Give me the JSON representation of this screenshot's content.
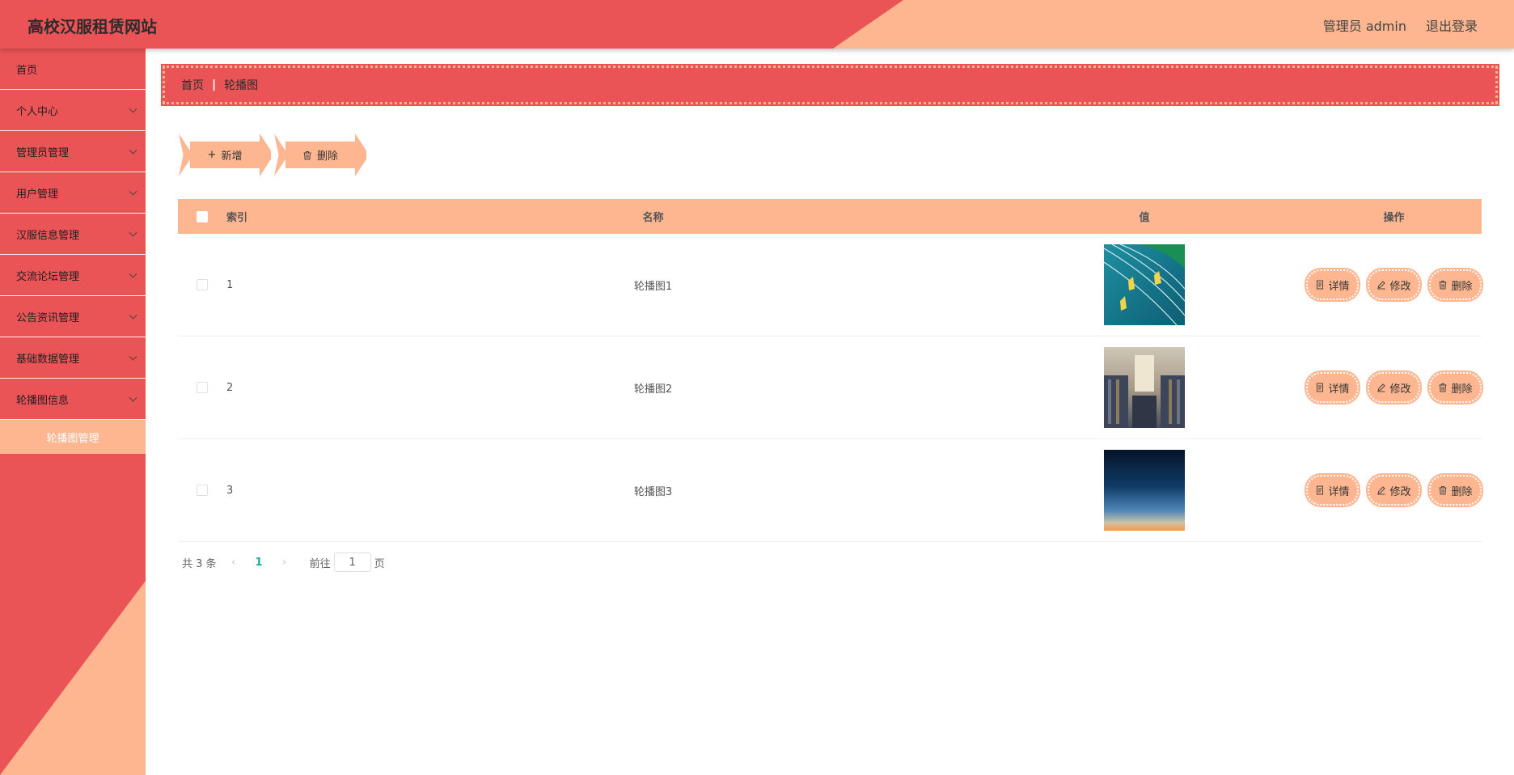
{
  "header": {
    "title": "高校汉服租赁网站",
    "user_label": "管理员 admin",
    "logout_label": "退出登录"
  },
  "sidebar": {
    "items": [
      {
        "label": "首页",
        "has_children": false
      },
      {
        "label": "个人中心",
        "has_children": true
      },
      {
        "label": "管理员管理",
        "has_children": true
      },
      {
        "label": "用户管理",
        "has_children": true
      },
      {
        "label": "汉服信息管理",
        "has_children": true
      },
      {
        "label": "交流论坛管理",
        "has_children": true
      },
      {
        "label": "公告资讯管理",
        "has_children": true
      },
      {
        "label": "基础数据管理",
        "has_children": true
      },
      {
        "label": "轮播图信息",
        "has_children": true
      }
    ],
    "active_subitem": "轮播图管理"
  },
  "breadcrumb": {
    "home": "首页",
    "separator": "|",
    "current": "轮播图"
  },
  "toolbar": {
    "add_label": "新增",
    "delete_label": "删除"
  },
  "table": {
    "columns": [
      "索引",
      "名称",
      "值",
      "操作"
    ],
    "rows": [
      {
        "index": "1",
        "name": "轮播图1",
        "image": "teal-running-track-image"
      },
      {
        "index": "2",
        "name": "轮播图2",
        "image": "library-hall-image"
      },
      {
        "index": "3",
        "name": "轮播图3",
        "image": "blue-orange-gradient-image"
      }
    ],
    "row_actions": {
      "detail": "详情",
      "edit": "修改",
      "delete": "删除"
    }
  },
  "pagination": {
    "total_text": "共 3 条",
    "current_page": "1",
    "goto_prefix": "前往",
    "goto_value": "1",
    "goto_suffix": "页"
  },
  "colors": {
    "primary_red": "#eb5457",
    "accent_peach": "#feb691",
    "page_number": "#1aa8a5"
  }
}
